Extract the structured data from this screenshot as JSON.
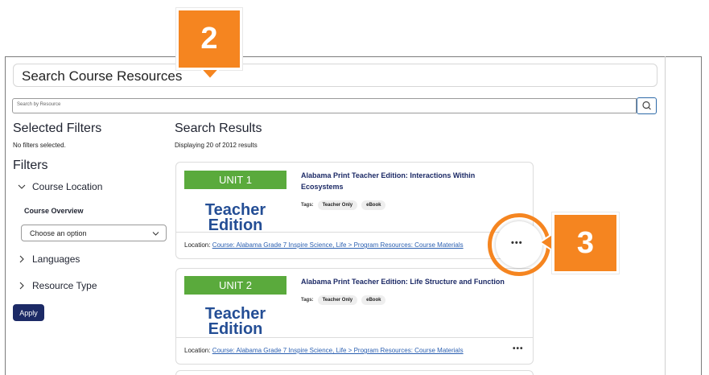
{
  "page": {
    "title": "Search Course Resources"
  },
  "search": {
    "placeholder": "Search by Resource"
  },
  "filters": {
    "selected_heading": "Selected Filters",
    "none_selected": "No filters selected.",
    "heading": "Filters",
    "course_location": {
      "label": "Course Location",
      "sub_label": "Course Overview",
      "select_value": "Choose an option"
    },
    "languages": {
      "label": "Languages"
    },
    "resource_type": {
      "label": "Resource Type"
    },
    "apply_label": "Apply"
  },
  "results": {
    "heading": "Search Results",
    "displaying": "Displaying 20 of 2012 results",
    "items": [
      {
        "unit": "UNIT 1",
        "thumb_line1": "Teacher",
        "thumb_line2": "Edition",
        "title_line1": "Alabama Print Teacher Edition: Interactions Within",
        "title_line2": "Ecosystems",
        "tags_label": "Tags:",
        "tags": [
          "Teacher Only",
          "eBook"
        ],
        "location_label": "Location:",
        "location_link": "Course: Alabama Grade 7 Inspire Science, Life > Program Resources: Course Materials",
        "more": "•••"
      },
      {
        "unit": "UNIT 2",
        "thumb_line1": "Teacher",
        "thumb_line2": "Edition",
        "title_line1": "Alabama Print Teacher Edition: Life Structure and Function",
        "tags_label": "Tags:",
        "tags": [
          "Teacher Only",
          "eBook"
        ],
        "location_label": "Location:",
        "location_link": "Course: Alabama Grade 7 Inspire Science, Life > Program Resources: Course Materials",
        "more": "•••"
      }
    ]
  },
  "callouts": {
    "step_a": "2",
    "step_b": "3"
  },
  "colors": {
    "accent_orange": "#f58520",
    "brand_navy": "#1c2a66",
    "unit_green": "#5aaa3c",
    "link_blue": "#2a5fb1"
  },
  "icons": {
    "search": "search-icon",
    "chevron_down": "chevron-down-icon",
    "chevron_right": "chevron-right-icon",
    "more": "more-options-icon"
  }
}
